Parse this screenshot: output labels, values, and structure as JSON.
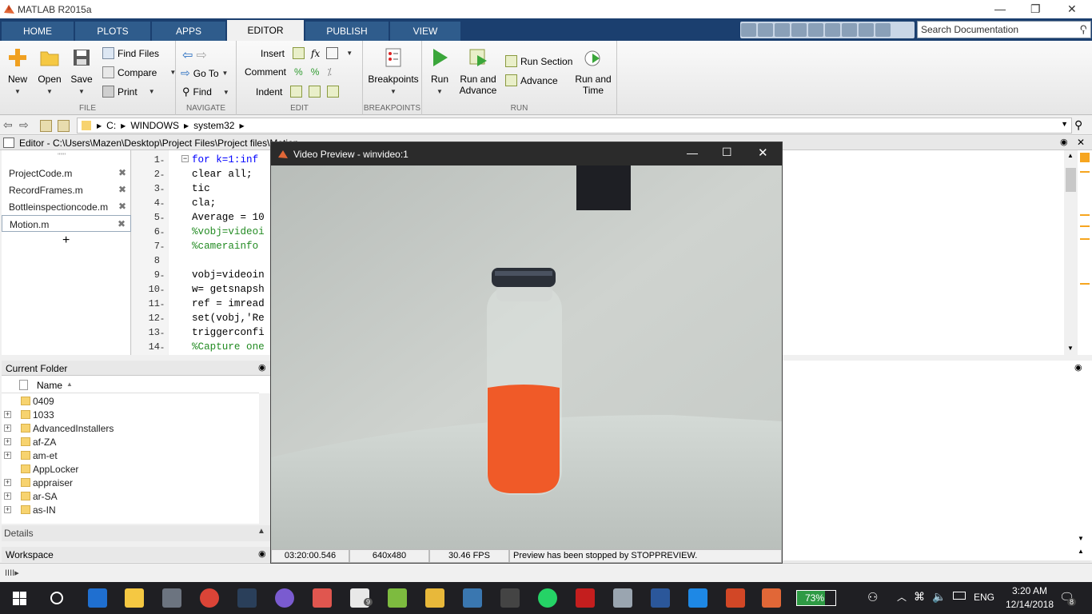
{
  "window": {
    "title": "MATLAB R2015a"
  },
  "tabs": [
    "HOME",
    "PLOTS",
    "APPS",
    "EDITOR",
    "PUBLISH",
    "VIEW"
  ],
  "active_tab": "EDITOR",
  "search": {
    "placeholder": "Search Documentation"
  },
  "ribbon": {
    "file": {
      "label": "FILE",
      "new": "New",
      "open": "Open",
      "save": "Save",
      "find_files": "Find Files",
      "compare": "Compare",
      "print": "Print"
    },
    "navigate": {
      "label": "NAVIGATE",
      "go_to": "Go To",
      "find": "Find"
    },
    "edit": {
      "label": "EDIT",
      "insert": "Insert",
      "comment": "Comment",
      "indent": "Indent",
      "fx": "fx"
    },
    "breakpoints": {
      "label": "BREAKPOINTS",
      "breakpoints": "Breakpoints"
    },
    "run": {
      "label": "RUN",
      "run": "Run",
      "run_and_advance": "Run and Advance",
      "run_section": "Run Section",
      "advance": "Advance",
      "run_and_time": "Run and Time"
    }
  },
  "address": {
    "parts": [
      "C:",
      "WINDOWS",
      "system32"
    ]
  },
  "editor": {
    "header": "Editor - C:\\Users\\Mazen\\Desktop\\Project Files\\Project files\\Motion",
    "files": [
      "ProjectCode.m",
      "RecordFrames.m",
      "Bottleinspectioncode.m",
      "Motion.m"
    ],
    "active_file": "Motion.m",
    "add_label": "+",
    "lines": [
      {
        "n": "1",
        "text": "for k=1:inf"
      },
      {
        "n": "2",
        "text": "clear all;"
      },
      {
        "n": "3",
        "text": "tic"
      },
      {
        "n": "4",
        "text": "cla;"
      },
      {
        "n": "5",
        "text": "Average = 10"
      },
      {
        "n": "6",
        "text": "%vobj=videoi"
      },
      {
        "n": "7",
        "text": "%camerainfo"
      },
      {
        "n": "8",
        "text": ""
      },
      {
        "n": "9",
        "text": "vobj=videoin"
      },
      {
        "n": "10",
        "text": "w= getsnapsh"
      },
      {
        "n": "11",
        "text": "ref = imread"
      },
      {
        "n": "12",
        "text": "set(vobj,'Re"
      },
      {
        "n": "13",
        "text": "triggerconfi"
      },
      {
        "n": "14",
        "text": "%Capture one"
      }
    ]
  },
  "current_folder": {
    "title": "Current Folder",
    "column": "Name",
    "items": [
      {
        "name": "0409",
        "expandable": false
      },
      {
        "name": "1033",
        "expandable": true
      },
      {
        "name": "AdvancedInstallers",
        "expandable": true
      },
      {
        "name": "af-ZA",
        "expandable": true
      },
      {
        "name": "am-et",
        "expandable": true
      },
      {
        "name": "AppLocker",
        "expandable": false
      },
      {
        "name": "appraiser",
        "expandable": true
      },
      {
        "name": "ar-SA",
        "expandable": true
      },
      {
        "name": "as-IN",
        "expandable": true
      }
    ]
  },
  "details": {
    "title": "Details"
  },
  "workspace": {
    "title": "Workspace"
  },
  "video": {
    "title": "Video Preview - winvideo:1",
    "timestamp": "03:20:00.546",
    "resolution": "640x480",
    "fps": "30.46 FPS",
    "status": "Preview has been stopped by STOPPREVIEW."
  },
  "taskbar": {
    "battery": "73%",
    "lang": "ENG",
    "time": "3:20 AM",
    "date": "12/14/2018",
    "notifications": "8",
    "mail_badge": "9"
  }
}
